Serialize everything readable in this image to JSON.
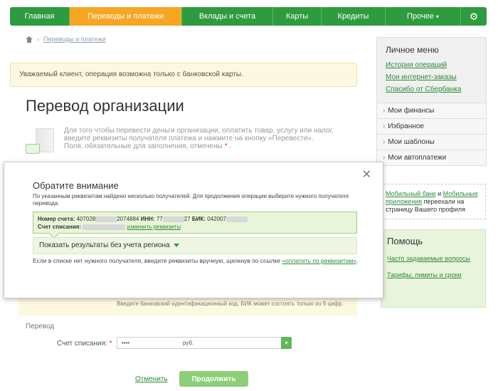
{
  "nav": {
    "items": [
      {
        "label": "Главная",
        "w": 84
      },
      {
        "label": "Переводы и платежи",
        "w": 158,
        "active": true
      },
      {
        "label": "Вклады и счета",
        "w": 128
      },
      {
        "label": "Карты",
        "w": 68
      },
      {
        "label": "Кредиты",
        "w": 90
      },
      {
        "label": "Прочее",
        "w": 106
      }
    ],
    "more_caret": "▾"
  },
  "breadcrumb": {
    "link": "Переводы и платежи"
  },
  "notice": {
    "text": "Уважаемый клиент, операция возможна только с банковской карты."
  },
  "page": {
    "title": "Перевод организации",
    "info_line": "Для того чтобы перевести деньги организации, оплатить товар, услугу или налог, введите реквизиты получателя платежа и нажмите на кнопку «Перевести».",
    "required_note": "Поля, обязательные для заполнения, отмечены",
    "required_mark": "*"
  },
  "sidebar": {
    "title": "Личное меню",
    "links": [
      "История операций",
      "Мои интернет-заказы",
      "Спасибо от Сбербанка"
    ],
    "items": [
      "Мои финансы",
      "Избранное",
      "Мои шаблоны",
      "Мои автоплатежи"
    ]
  },
  "promo": {
    "link1": "Мобильный банк",
    "and": " и ",
    "link2": "Мобильные приложения",
    "rest": " переехали на страницу Вашего профиля"
  },
  "help": {
    "title": "Помощь",
    "links": [
      "Часто задаваемые вопросы",
      "Тарифы, лимиты и сроки"
    ]
  },
  "form": {
    "bik_hint": "Введите банковский идентификационный код. БИК может состоять только из 9 цифр.",
    "section_label": "Перевод",
    "account_label": "Счет списания:",
    "required_mark": "*",
    "account_value": "••••",
    "currency": "руб.",
    "cancel": "Отменить",
    "continue": "Продолжить"
  },
  "modal": {
    "title": "Обратите внимание",
    "desc": "По указанным реквизитам найдено несколько получателей. Для продолжения операции выберите нужного получателя перевода.",
    "account_label": "Номер счета:",
    "account_start": "407028",
    "account_end": "2074884",
    "inn_label": "ИНН:",
    "inn_start": "77",
    "inn_end": "27",
    "bik_label": "БИК:",
    "bik_start": "042007",
    "debit_label": "Счет списания:",
    "change_link": "изменить реквизиты",
    "show_results": "Показать результаты без учета региона",
    "hint": "Если в списке нет нужного получателя, введите реквизиты вручную, щелкнув по ссылке ",
    "hint_link": "«оплатить по реквизитам»",
    "hint_end": "."
  }
}
